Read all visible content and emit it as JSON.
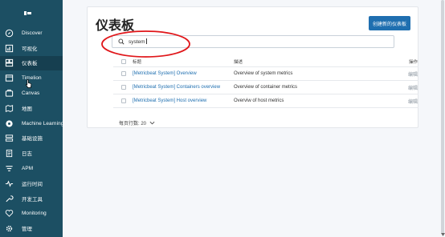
{
  "sidebar": {
    "items": [
      {
        "label": "Discover",
        "icon": "compass-icon",
        "active": false
      },
      {
        "label": "可视化",
        "icon": "visualize-icon",
        "active": false
      },
      {
        "label": "仪表板",
        "icon": "dashboard-icon",
        "active": true
      },
      {
        "label": "Timelion",
        "icon": "timelion-icon",
        "active": false
      },
      {
        "label": "Canvas",
        "icon": "canvas-icon",
        "active": false
      },
      {
        "label": "地图",
        "icon": "map-icon",
        "active": false
      },
      {
        "label": "Machine Learning",
        "icon": "machine-learning-icon",
        "active": false
      },
      {
        "label": "基础设施",
        "icon": "infrastructure-icon",
        "active": false
      },
      {
        "label": "日志",
        "icon": "logs-icon",
        "active": false
      },
      {
        "label": "APM",
        "icon": "apm-icon",
        "active": false
      },
      {
        "label": "运行时间",
        "icon": "uptime-icon",
        "active": false
      },
      {
        "label": "开发工具",
        "icon": "dev-tools-icon",
        "active": false
      },
      {
        "label": "Monitoring",
        "icon": "monitoring-icon",
        "active": false
      },
      {
        "label": "管理",
        "icon": "gear-icon",
        "active": false
      }
    ]
  },
  "main": {
    "title": "仪表板",
    "create_button": "创建新的仪表板",
    "search": {
      "value": "system",
      "icon": "search-icon"
    },
    "table": {
      "headers": {
        "title": "标题",
        "description": "描述",
        "actions": "操作"
      },
      "rows": [
        {
          "title": "[Metricbeat System] Overview",
          "description": "Overview of system metrics",
          "action": "编辑"
        },
        {
          "title": "[Metricbeat System] Containers overview",
          "description": "Overview of container metrics",
          "action": "编辑"
        },
        {
          "title": "[Metricbeat System] Host overview",
          "description": "Overviw of host metrics",
          "action": "编辑"
        }
      ]
    },
    "pagination": {
      "rows_per_page": "每页行数: 20"
    }
  },
  "colors": {
    "sidebar_bg": "#1c4f63",
    "accent": "#1f6fb0",
    "annotation": "#e0161a"
  }
}
